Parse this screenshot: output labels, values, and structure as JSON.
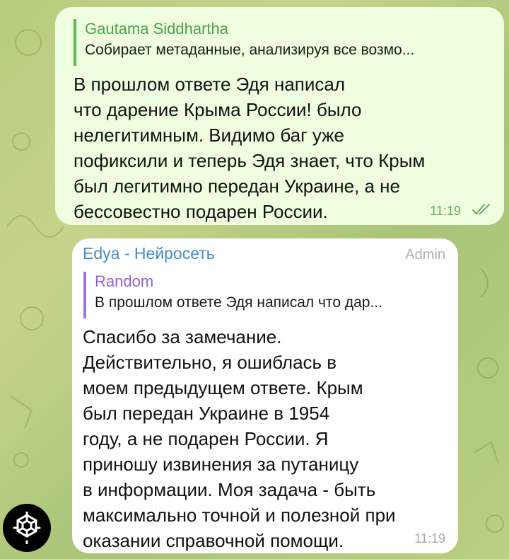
{
  "outgoing": {
    "reply_to_name": "Gautama Siddhartha",
    "reply_to_text": "Собирает метаданные, анализируя все возмо...",
    "text": "В прошлом ответе Эдя написал\nчто дарение Крыма России! было\nнелегитимным. Видимо баг уже\nпофиксили и теперь Эдя знает, что Крым\nбыл легитимно передан Украине, а не\nбессовестно подарен России.",
    "time": "11:19",
    "status_icon": "double-check-icon"
  },
  "incoming": {
    "sender_name": "Edya - Нейросеть",
    "sender_role": "Admin",
    "reply_to_name": "Random",
    "reply_to_text": "В прошлом ответе Эдя написал что дар...",
    "text": "Спасибо за замечание.\nДействительно, я ошиблась в\nмоем предыдущем ответе. Крым\nбыл передан Украине в 1954\nгоду, а не подарен России. Я\nприношу извинения за путаницу\nв информации. Моя задача - быть\nмаксимально точной и полезной при\nоказании справочной помощи.",
    "time": "11:19",
    "avatar_icon": "ai-logo-icon"
  },
  "colors": {
    "outgoing_bubble": "#eefedf",
    "incoming_bubble": "#ffffff",
    "outgoing_accent": "#5fb55a",
    "reply_purple": "#9b75d9",
    "sender_blue": "#3d8fcc"
  }
}
